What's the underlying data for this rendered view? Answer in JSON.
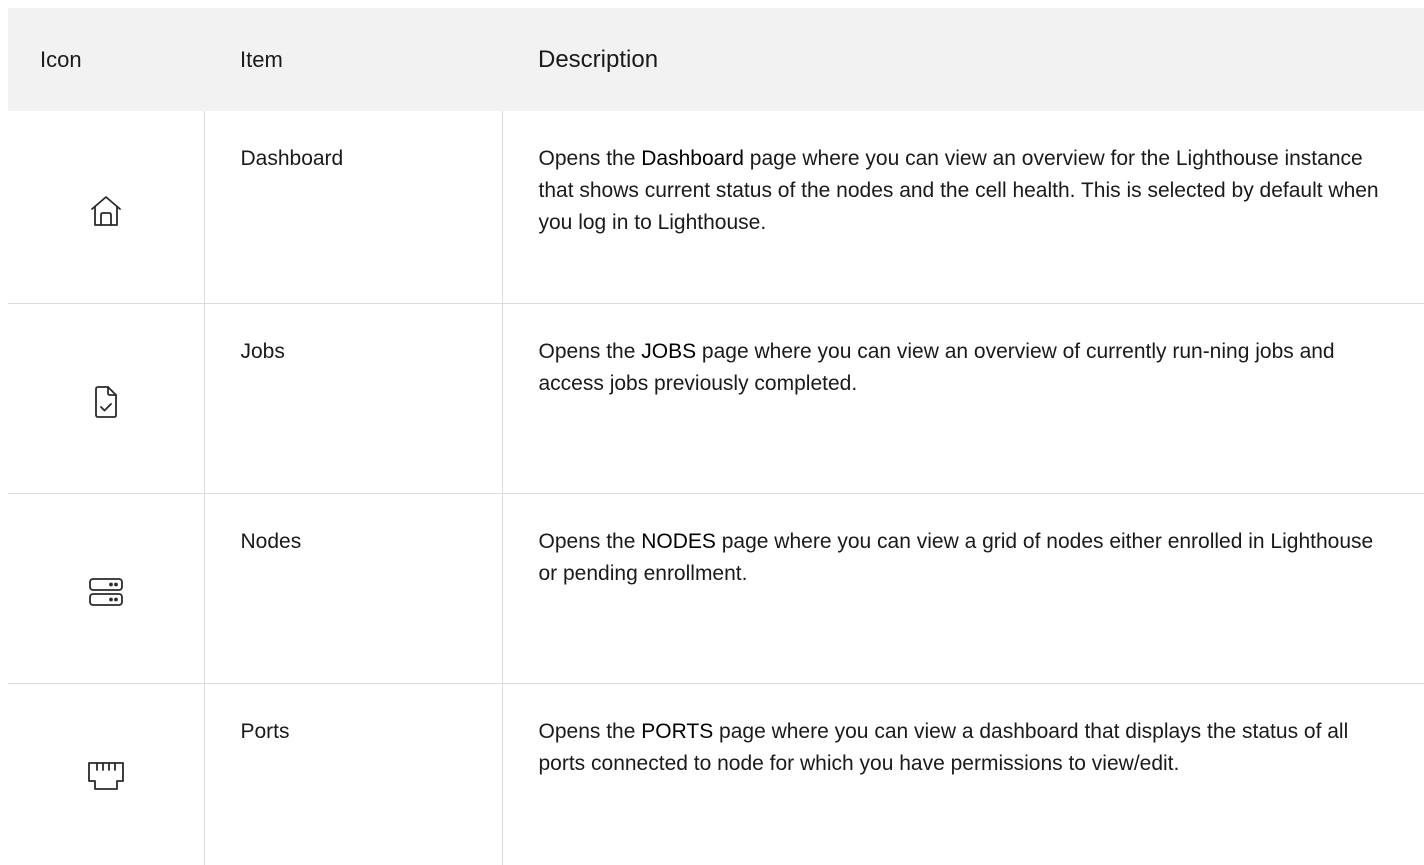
{
  "headers": {
    "icon": "Icon",
    "item": "Item",
    "description": "Description"
  },
  "rows": [
    {
      "icon": "home-icon",
      "item": "Dashboard",
      "desc_before": "Opens the ",
      "desc_keyword": "Dashboard",
      "desc_after": " page where you can view an overview for the Lighthouse instance that shows current status of the nodes and the cell health. This is selected by default when you log in to Lighthouse."
    },
    {
      "icon": "file-check-icon",
      "item": "Jobs",
      "desc_before": "Opens the ",
      "desc_keyword": "JOBS",
      "desc_after": " page where you can view an overview of currently run-ning jobs and access jobs previously completed."
    },
    {
      "icon": "server-icon",
      "item": "Nodes",
      "desc_before": "Opens the ",
      "desc_keyword": "NODES",
      "desc_after": " page where you can view a grid of nodes either enrolled in Lighthouse or pending enrollment."
    },
    {
      "icon": "ethernet-port-icon",
      "item": "Ports",
      "desc_before": "Opens the ",
      "desc_keyword": "PORTS",
      "desc_after": " page where you can view a dashboard that displays the status of all ports connected to node for which you have permissions to view/edit."
    }
  ]
}
